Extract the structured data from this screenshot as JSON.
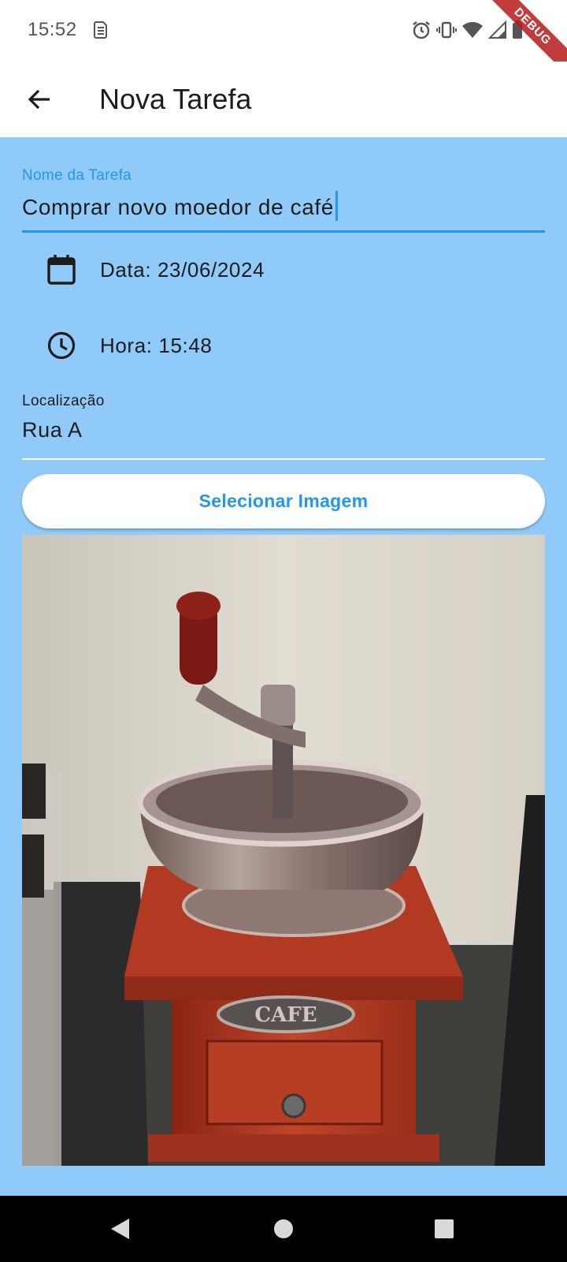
{
  "status_bar": {
    "time": "15:52",
    "icons": [
      "sim-card-icon",
      "alarm-icon",
      "vibrate-icon",
      "wifi-icon",
      "signal-icon",
      "battery-icon"
    ],
    "debug_banner": "DEBUG"
  },
  "app_bar": {
    "back_icon": "arrow-back-icon",
    "title": "Nova Tarefa"
  },
  "form": {
    "task_name": {
      "label": "Nome da Tarefa",
      "value": "Comprar novo moedor de café"
    },
    "date": {
      "icon": "calendar-icon",
      "text": "Data: 23/06/2024"
    },
    "time": {
      "icon": "clock-icon",
      "text": "Hora: 15:48"
    },
    "location": {
      "label": "Localização",
      "value": "Rua A"
    },
    "select_image_button": "Selecionar Imagem",
    "image": {
      "description_icon": "coffee-grinder-photo",
      "label": "CAFE"
    }
  },
  "nav_bar": {
    "icons": [
      "back-triangle-icon",
      "home-circle-icon",
      "recents-square-icon"
    ]
  },
  "colors": {
    "background": "#90caf9",
    "accent": "#2196f3",
    "app_bar": "#ffffff",
    "nav_bar": "#000000"
  }
}
